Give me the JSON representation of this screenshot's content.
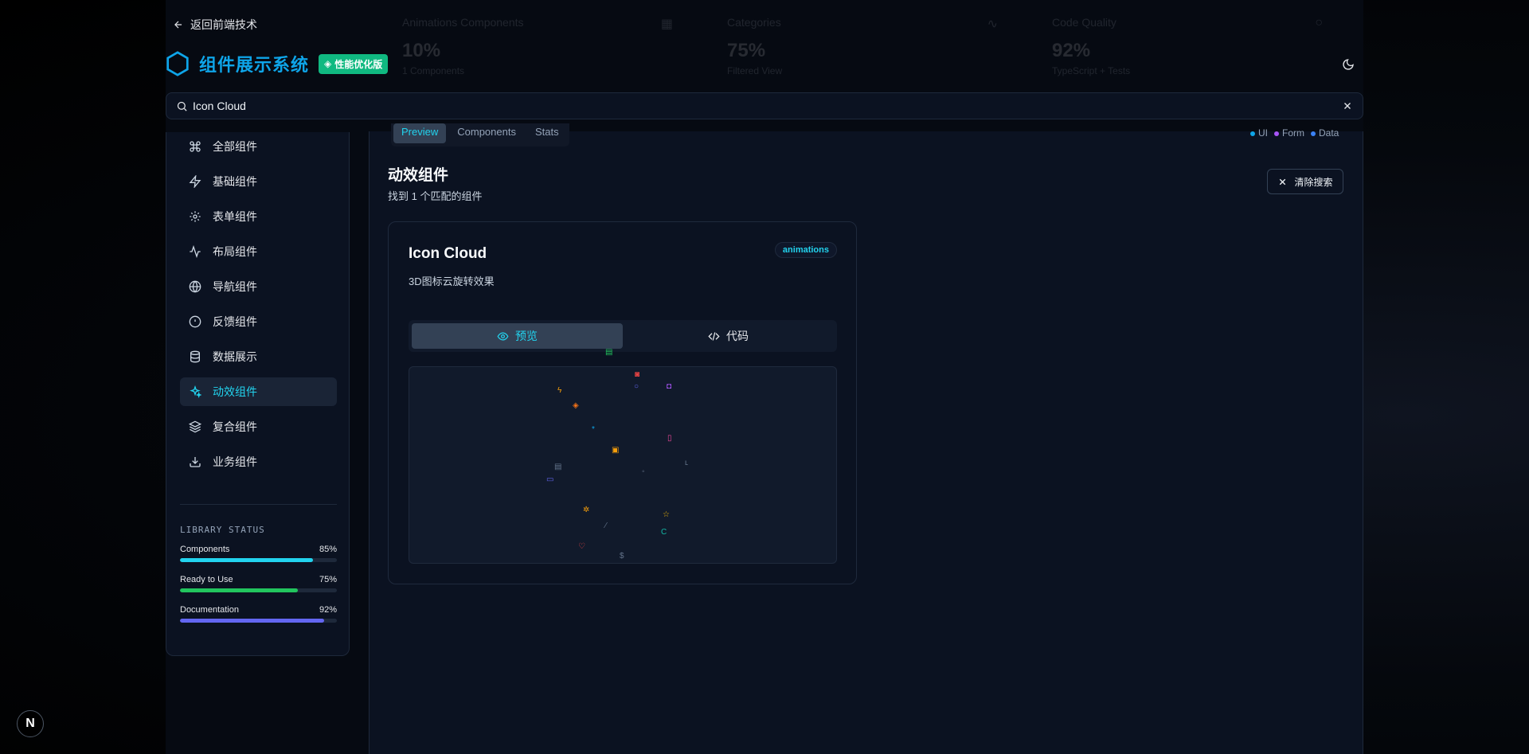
{
  "header": {
    "back_label": "返回前端技术",
    "brand_title": "组件展示系统",
    "brand_badge": "性能优化版"
  },
  "stats": [
    {
      "title": "Animations Components",
      "value": "10%",
      "sub": "1 Components"
    },
    {
      "title": "Categories",
      "value": "75%",
      "sub": "Filtered View"
    },
    {
      "title": "Code Quality",
      "value": "92%",
      "sub": "TypeScript + Tests"
    }
  ],
  "search": {
    "value": "Icon Cloud",
    "placeholder": ""
  },
  "sidebar": {
    "items": [
      {
        "label": "全部组件",
        "icon": "command-icon"
      },
      {
        "label": "基础组件",
        "icon": "zap-icon"
      },
      {
        "label": "表单组件",
        "icon": "gear-icon"
      },
      {
        "label": "布局组件",
        "icon": "activity-icon"
      },
      {
        "label": "导航组件",
        "icon": "globe-icon"
      },
      {
        "label": "反馈组件",
        "icon": "alert-circle-icon"
      },
      {
        "label": "数据展示",
        "icon": "database-icon"
      },
      {
        "label": "动效组件",
        "icon": "sparkles-icon",
        "active": true
      },
      {
        "label": "复合组件",
        "icon": "layers-icon"
      },
      {
        "label": "业务组件",
        "icon": "download-icon"
      }
    ],
    "library_status": {
      "heading": "LIBRARY STATUS",
      "bars": [
        {
          "label": "Components",
          "pct_label": "85%",
          "value": 0.85,
          "color": "#22d3ee"
        },
        {
          "label": "Ready to Use",
          "pct_label": "75%",
          "value": 0.75,
          "color": "#22c55e"
        },
        {
          "label": "Documentation",
          "pct_label": "92%",
          "value": 0.92,
          "color": "#6366f1"
        }
      ]
    }
  },
  "main": {
    "tabs": [
      {
        "label": "Preview",
        "active": true
      },
      {
        "label": "Components"
      },
      {
        "label": "Stats"
      }
    ],
    "legend": [
      {
        "label": "UI",
        "color": "#0ea5e9"
      },
      {
        "label": "Form",
        "color": "#a855f7"
      },
      {
        "label": "Data",
        "color": "#3b82f6"
      }
    ],
    "section_title": "动效组件",
    "section_sub": "找到 1 个匹配的组件",
    "clear_search_label": "清除搜索",
    "card": {
      "title": "Icon Cloud",
      "description": "3D图标云旋转效果",
      "tag": "animations",
      "preview_label": "预览",
      "code_label": "代码"
    }
  },
  "colors": {
    "accent": "#22d3ee",
    "brand": "#0ea5e9",
    "badge": "#10b981"
  }
}
